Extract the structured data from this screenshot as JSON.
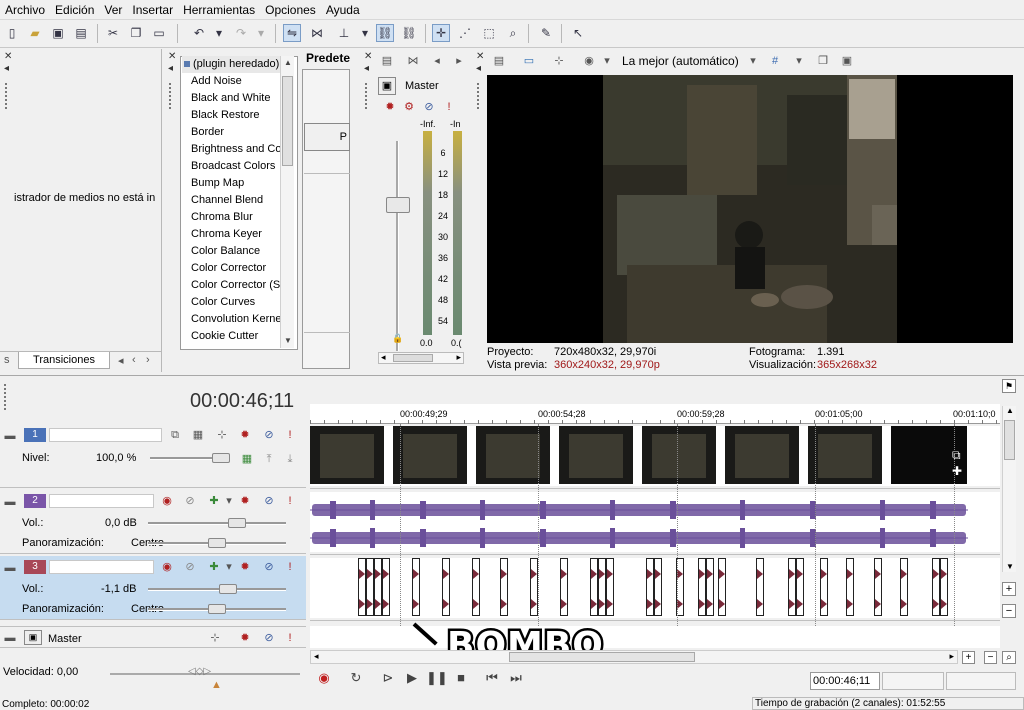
{
  "menu": [
    "Archivo",
    "Edición",
    "Ver",
    "Insertar",
    "Herramientas",
    "Opciones",
    "Ayuda"
  ],
  "media_panel": {
    "message": "istrador de medios no está in",
    "tab_partial": "s",
    "tab_label": "Transiciones"
  },
  "fx_list": {
    "items": [
      "(plugin heredado)",
      "Add Noise",
      "Black and White",
      "Black Restore",
      "Border",
      "Brightness and Co",
      "Broadcast Colors",
      "Bump Map",
      "Channel Blend",
      "Chroma Blur",
      "Chroma Keyer",
      "Color Balance",
      "Color Corrector",
      "Color Corrector (S",
      "Color Curves",
      "Convolution Kerne",
      "Cookie Cutter"
    ],
    "presets_header": "Predete",
    "presets_partial": "P"
  },
  "mixer": {
    "master_label": "Master",
    "peak_left": "-Inf.",
    "peak_right": "-In",
    "scale": [
      "6",
      "12",
      "18",
      "24",
      "30",
      "36",
      "42",
      "48",
      "54"
    ],
    "bottom_left": "0.0",
    "bottom_right": "0.("
  },
  "preview": {
    "quality": "La mejor (automático)",
    "project_label": "Proyecto:",
    "project_value": "720x480x32, 29,970i",
    "preview_label": "Vista previa:",
    "preview_value": "360x240x32, 29,970p",
    "frame_label": "Fotograma:",
    "frame_value": "1.391",
    "display_label": "Visualización:",
    "display_value": "365x268x32"
  },
  "timeline": {
    "timecode": "00:00:46;11",
    "ruler": [
      "00:00:49;29",
      "00:00:54;28",
      "00:00:59;28",
      "00:01:05;00",
      "00:01:10;0"
    ],
    "cursor_time": "00:00:46;11",
    "overlay_text": "BOMBO"
  },
  "tracks": [
    {
      "num": "1",
      "param_label": "Nivel:",
      "param_value": "100,0 %",
      "color": "#4a72b8",
      "level": 1.0
    },
    {
      "num": "2",
      "param_label": "Vol.:",
      "param_value": "0,0 dB",
      "pan_label": "Panoramización:",
      "pan_value": "Centro",
      "color": "#7a55a8",
      "volume_db": 0.0
    },
    {
      "num": "3",
      "param_label": "Vol.:",
      "param_value": "-1,1 dB",
      "pan_label": "Panoramización:",
      "pan_value": "Centro",
      "color": "#a84858",
      "volume_db": -1.1
    }
  ],
  "master_bus": {
    "label": "Master"
  },
  "speed": {
    "label": "Velocidad: 0,00"
  },
  "status": {
    "left": "Completo: 00:00:02",
    "right": "Tiempo de grabación (2 canales): 01:52:55"
  },
  "colors": {
    "selected_track": "#c6dcf0",
    "waveform": "#6a4f9a",
    "accent_red": "#a01818"
  }
}
